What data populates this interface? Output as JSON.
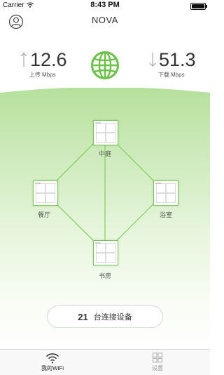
{
  "status_bar": {
    "carrier": "Carrier",
    "time": "8:43 PM",
    "icons": [
      "wifi-icon",
      "battery-icon"
    ]
  },
  "nav": {
    "title": "NOVA",
    "profile_icon": "profile-icon"
  },
  "speed": {
    "upload": {
      "value": "12.6",
      "label": "上传",
      "unit": "Mbps",
      "icon": "arrow-up-icon"
    },
    "download": {
      "value": "51.3",
      "label": "下载",
      "unit": "Mbps",
      "icon": "arrow-down-icon"
    },
    "center_icon": "globe-icon"
  },
  "topology": {
    "nodes": [
      {
        "label": "中庭",
        "tag": "NOVA"
      },
      {
        "label": "餐厅",
        "tag": "NOVA"
      },
      {
        "label": "浴室",
        "tag": "NOVA"
      },
      {
        "label": "书房",
        "tag": "NOVA"
      }
    ]
  },
  "devices": {
    "count": "21",
    "label": "台连接设备"
  },
  "tabbar": {
    "tabs": [
      {
        "label": "我的WiFi",
        "icon": "wifi-icon",
        "active": true
      },
      {
        "label": "设置",
        "icon": "settings-icon",
        "active": false
      }
    ]
  },
  "colors": {
    "accent": "#6cc04a",
    "line": "#7fcf5a",
    "text": "#333333"
  }
}
